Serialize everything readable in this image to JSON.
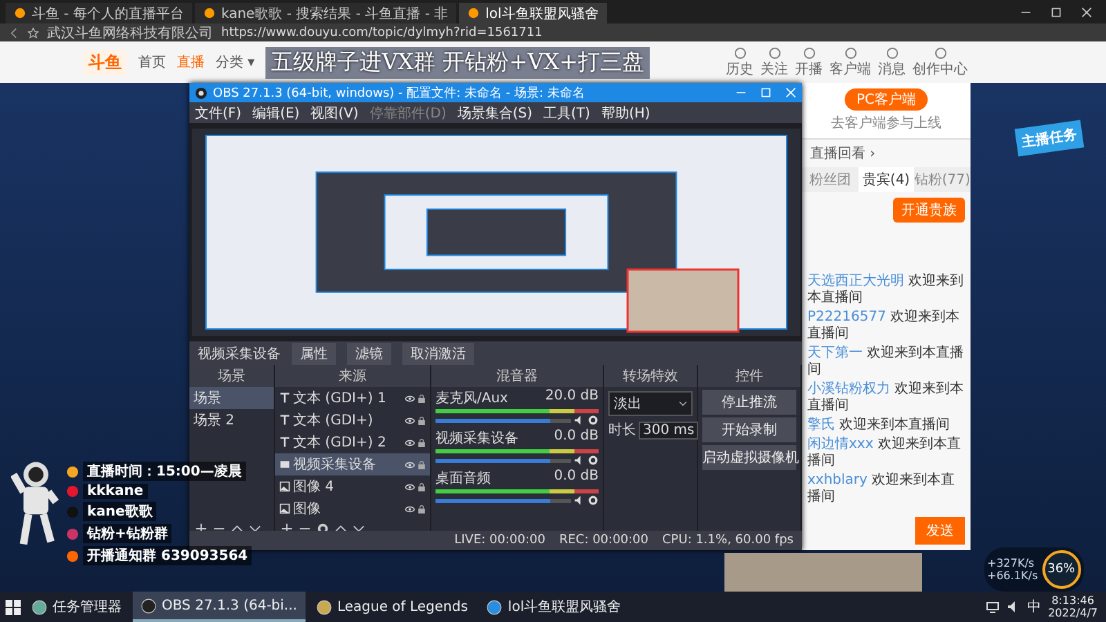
{
  "browser": {
    "tabs": [
      {
        "label": "斗鱼 - 每个人的直播平台",
        "selected": false
      },
      {
        "label": "kane歌歌 - 搜索结果 - 斗鱼直播 - 非",
        "selected": false
      },
      {
        "label": "lol斗鱼联盟风骚舍",
        "selected": true
      }
    ],
    "site_name": "武汉斗鱼网络科技有限公司",
    "url": "https://www.douyu.com/topic/dylmyh?rid=1561711"
  },
  "page": {
    "logo": "斗鱼",
    "nav": [
      {
        "label": "首页",
        "selected": false
      },
      {
        "label": "直播",
        "selected": true
      },
      {
        "label": "分类 ▾",
        "selected": false
      }
    ],
    "header_icons": [
      {
        "label": "历史"
      },
      {
        "label": "关注"
      },
      {
        "label": "开播"
      },
      {
        "label": "客户端"
      },
      {
        "label": "消息"
      },
      {
        "label": "创作中心"
      }
    ],
    "banner_text": "五级牌子进VX群  开钻粉+VX+打三盘",
    "side_panel": {
      "client_button": "PC客户端",
      "client_note": "去客户端参与上线",
      "replay_link": "直播回看 ›",
      "tabs": [
        {
          "label": "粉丝团",
          "selected": false
        },
        {
          "label": "贵宾(4)",
          "selected": true
        },
        {
          "label": "钻粉(77)",
          "selected": false
        }
      ],
      "noble_button": "开通贵族",
      "chat": [
        {
          "user": "天选西正大光明",
          "message": "欢迎来到本直播间"
        },
        {
          "user": "P22216577",
          "message": "欢迎来到本直播间"
        },
        {
          "user": "天下第一",
          "message": "欢迎来到本直播间"
        },
        {
          "user": "小溪钻粉权力",
          "message": "欢迎来到本直播间"
        },
        {
          "user": "擎氏",
          "message": "欢迎来到本直播间"
        },
        {
          "user": "闲边情xxx",
          "message": "欢迎来到本直播间"
        },
        {
          "user": "xxhblary",
          "message": "欢迎来到本直播间"
        }
      ],
      "send_button": "发送"
    },
    "task_badge": "主播任务",
    "overlay_lines": [
      {
        "kind": "time",
        "text": "直播时间：15:00—凌晨"
      },
      {
        "kind": "weibo",
        "text": "kkkane"
      },
      {
        "kind": "douyin",
        "text": "kane歌歌"
      },
      {
        "kind": "fans",
        "text": "钻粉+钻粉群"
      },
      {
        "kind": "group",
        "text": "开播通知群 639093564"
      }
    ],
    "gauge": {
      "percent": "36%",
      "up": "+327K/s",
      "down": "+66.1K/s"
    }
  },
  "obs": {
    "title": "OBS 27.1.3 (64-bit, windows) - 配置文件: 未命名 - 场景: 未命名",
    "menu": [
      {
        "label": "文件(F)",
        "disabled": false
      },
      {
        "label": "编辑(E)",
        "disabled": false
      },
      {
        "label": "视图(V)",
        "disabled": false
      },
      {
        "label": "停靠部件(D)",
        "disabled": true
      },
      {
        "label": "场景集合(S)",
        "disabled": false
      },
      {
        "label": "工具(T)",
        "disabled": false
      },
      {
        "label": "帮助(H)",
        "disabled": false
      }
    ],
    "source_bar": {
      "name": "视频采集设备",
      "buttons": [
        "属性",
        "滤镜",
        "取消激活"
      ]
    },
    "scenes": {
      "title": "场景",
      "items": [
        {
          "label": "场景",
          "selected": true
        },
        {
          "label": "场景 2",
          "selected": false
        }
      ]
    },
    "sources": {
      "title": "来源",
      "items": [
        {
          "label": "文本 (GDI+) 1",
          "kind": "text",
          "selected": false
        },
        {
          "label": "文本 (GDI+)",
          "kind": "text",
          "selected": false
        },
        {
          "label": "文本 (GDI+) 2",
          "kind": "text",
          "selected": false
        },
        {
          "label": "视频采集设备",
          "kind": "camera",
          "selected": true
        },
        {
          "label": "图像 4",
          "kind": "image",
          "selected": false
        },
        {
          "label": "图像",
          "kind": "image",
          "selected": false
        }
      ]
    },
    "mixer": {
      "title": "混音器",
      "channels": [
        {
          "name": "麦克风/Aux",
          "reading": "20.0 dB",
          "level": 0.85
        },
        {
          "name": "视频采集设备",
          "reading": "0.0 dB",
          "level": 0.85
        },
        {
          "name": "桌面音频",
          "reading": "0.0 dB",
          "level": 0.85
        }
      ]
    },
    "transitions": {
      "title": "转场特效",
      "type": "淡出",
      "duration_label": "时长",
      "duration": "300 ms"
    },
    "controls": {
      "title": "控件",
      "buttons": [
        "停止推流",
        "开始录制",
        "启动虚拟摄像机"
      ]
    },
    "status": [
      "LIVE: 00:00:00",
      "REC: 00:00:00",
      "CPU: 1.1%, 60.00 fps"
    ]
  },
  "taskbar": {
    "items": [
      {
        "label": "任务管理器",
        "kind": "taskmgr",
        "selected": false
      },
      {
        "label": "OBS 27.1.3 (64-bi...",
        "kind": "obs",
        "selected": true
      },
      {
        "label": "League of Legends",
        "kind": "lol",
        "selected": false
      },
      {
        "label": "lol斗鱼联盟风骚舍",
        "kind": "browser",
        "selected": false
      }
    ],
    "ime": "中",
    "time": "8:13:46",
    "date": "2022/4/7"
  }
}
